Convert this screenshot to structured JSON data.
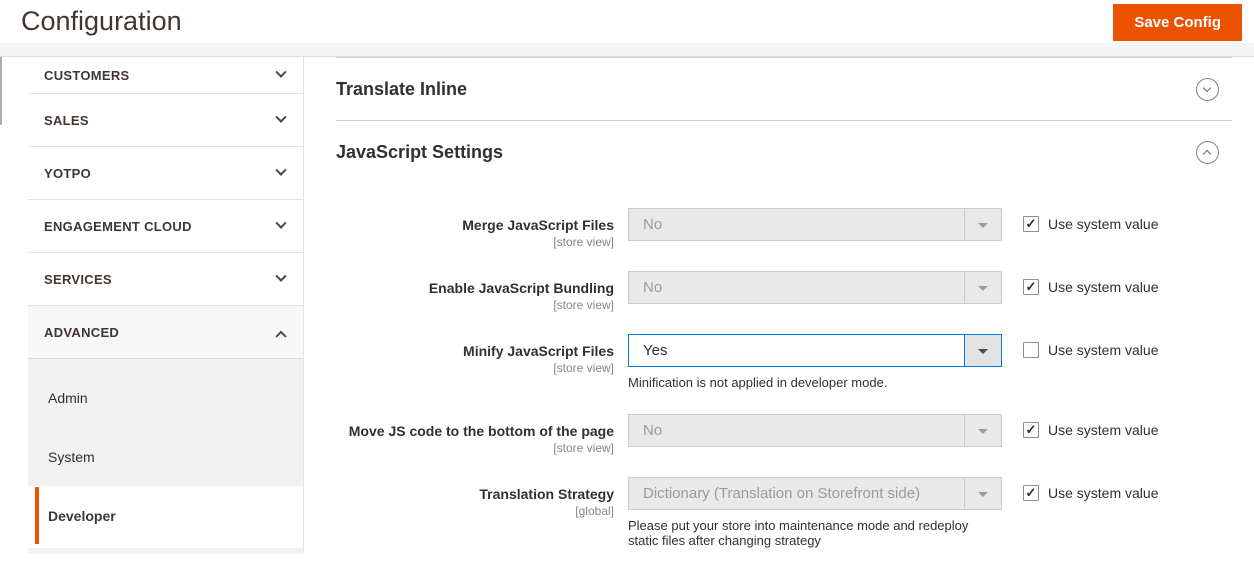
{
  "page": {
    "title": "Configuration"
  },
  "header": {
    "save_button": "Save Config"
  },
  "colors": {
    "accent_orange": "#eb5202",
    "focus_blue": "#007bdb"
  },
  "icons": {
    "checkmark": "✓",
    "chevron_down": "chevron-down",
    "chevron_up": "chevron-up",
    "caret_down": "caret-down"
  },
  "sidebar": {
    "sections": [
      {
        "label": "CUSTOMERS",
        "state": "collapsed"
      },
      {
        "label": "SALES",
        "state": "collapsed"
      },
      {
        "label": "YOTPO",
        "state": "collapsed"
      },
      {
        "label": "ENGAGEMENT CLOUD",
        "state": "collapsed"
      },
      {
        "label": "SERVICES",
        "state": "collapsed"
      },
      {
        "label": "ADVANCED",
        "state": "expanded"
      }
    ],
    "advanced_items": [
      {
        "label": "Admin",
        "active": false
      },
      {
        "label": "System",
        "active": false
      },
      {
        "label": "Developer",
        "active": true
      }
    ]
  },
  "sections": [
    {
      "title": "Translate Inline",
      "state": "collapsed"
    },
    {
      "title": "JavaScript Settings",
      "state": "expanded"
    }
  ],
  "form": {
    "use_system_value_label": "Use system value",
    "rows": [
      {
        "label": "Merge JavaScript Files",
        "scope": "[store view]",
        "value": "No",
        "disabled": true,
        "use_system_value": true,
        "note": ""
      },
      {
        "label": "Enable JavaScript Bundling",
        "scope": "[store view]",
        "value": "No",
        "disabled": true,
        "use_system_value": true,
        "note": ""
      },
      {
        "label": "Minify JavaScript Files",
        "scope": "[store view]",
        "value": "Yes",
        "disabled": false,
        "use_system_value": false,
        "note": "Minification is not applied in developer mode."
      },
      {
        "label": "Move JS code to the bottom of the page",
        "scope": "[store view]",
        "value": "No",
        "disabled": true,
        "use_system_value": true,
        "note": ""
      },
      {
        "label": "Translation Strategy",
        "scope": "[global]",
        "value": "Dictionary (Translation on Storefront side)",
        "disabled": true,
        "use_system_value": true,
        "note": "Please put your store into maintenance mode and redeploy static files after changing strategy"
      }
    ]
  }
}
